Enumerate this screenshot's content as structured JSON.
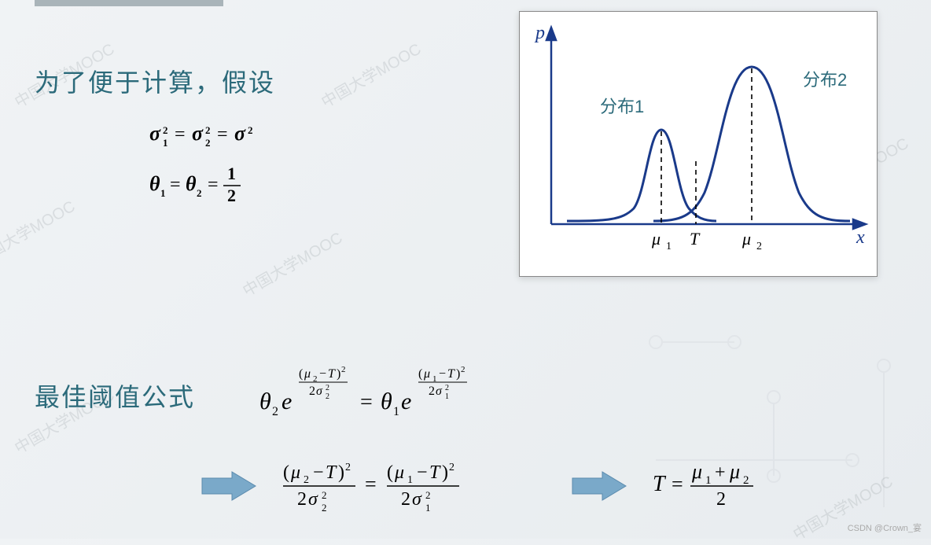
{
  "heading1": "为了便于计算，假设",
  "heading2": "最佳阈值公式",
  "equations": {
    "assumption1": "σ₁² = σ₂² = σ²",
    "assumption2": "θ₁ = θ₂ = 1/2",
    "main": "θ₂ e^{(μ₂−T)²/(2σ₂²)} = θ₁ e^{(μ₁−T)²/(2σ₁²)}",
    "step": "(μ₂−T)²/(2σ₂²) = (μ₁−T)²/(2σ₁²)",
    "result": "T = (μ₁ + μ₂)/2"
  },
  "chart": {
    "yaxis": "p",
    "xaxis": "x",
    "dist1_label": "分布1",
    "dist2_label": "分布2",
    "mu1": "μ",
    "mu1_sub": "1",
    "T": "T",
    "mu2": "μ",
    "mu2_sub": "2",
    "color_axis": "#1a3a8a",
    "color_curve": "#1a3a8a",
    "color_label": "#2b6a7a"
  },
  "watermark": "中国大学MOOC",
  "footer": "CSDN @Crown_宴"
}
